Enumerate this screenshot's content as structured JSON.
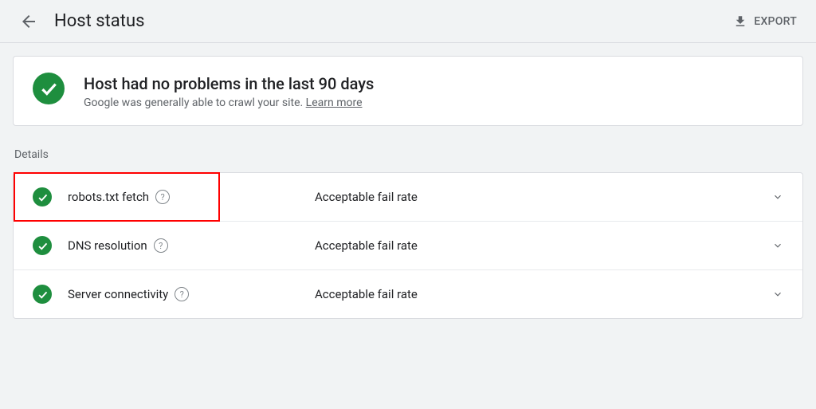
{
  "header": {
    "title": "Host status",
    "export_label": "EXPORT"
  },
  "summary": {
    "title": "Host had no problems in the last 90 days",
    "subtitle": "Google was generally able to crawl your site. ",
    "learn_more": "Learn more"
  },
  "details": {
    "section_label": "Details",
    "items": [
      {
        "label": "robots.txt fetch",
        "status": "Acceptable fail rate",
        "highlighted": true
      },
      {
        "label": "DNS resolution",
        "status": "Acceptable fail rate",
        "highlighted": false
      },
      {
        "label": "Server connectivity",
        "status": "Acceptable fail rate",
        "highlighted": false
      }
    ]
  }
}
